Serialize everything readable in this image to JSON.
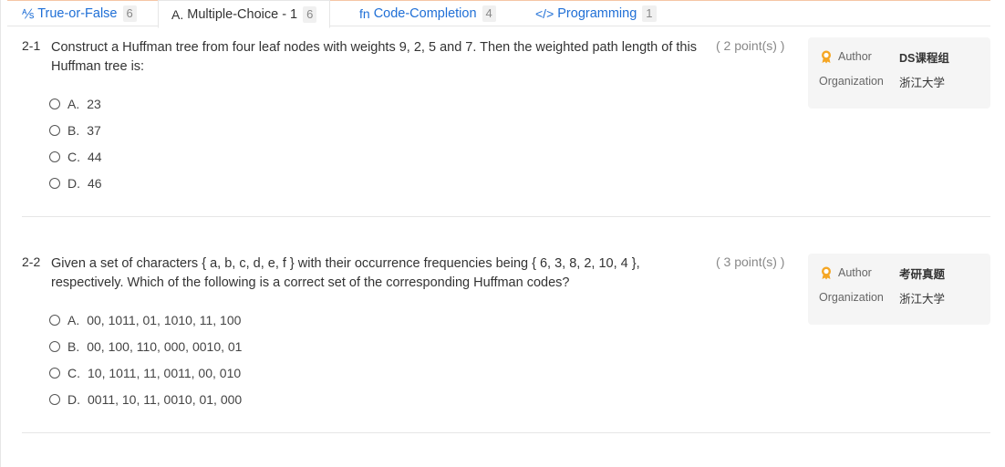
{
  "tabs": [
    {
      "icon": "⅍",
      "label": "True-or-False",
      "count": "6"
    },
    {
      "icon": "A.",
      "label": "Multiple-Choice - 1",
      "count": "6"
    },
    {
      "icon": "fn",
      "label": "Code-Completion",
      "count": "4"
    },
    {
      "icon": "</>",
      "label": "Programming",
      "count": "1"
    }
  ],
  "questions": [
    {
      "number": "2-1",
      "text": "Construct a Huffman tree from four leaf nodes with weights 9, 2, 5 and 7. Then the weighted path length of this Huffman tree is:",
      "points": "( 2 point(s) )",
      "options": [
        {
          "letter": "A.",
          "text": "23"
        },
        {
          "letter": "B.",
          "text": "37"
        },
        {
          "letter": "C.",
          "text": "44"
        },
        {
          "letter": "D.",
          "text": "46"
        }
      ],
      "author_label": "Author",
      "author": "DS课程组",
      "org_label": "Organization",
      "organization": "浙江大学"
    },
    {
      "number": "2-2",
      "text": "Given a set of characters { a, b, c, d, e, f } with their occurrence frequencies being { 6, 3, 8, 2, 10, 4 }, respectively. Which of the following is a correct set of the corresponding Huffman codes?",
      "points": "( 3 point(s) )",
      "options": [
        {
          "letter": "A.",
          "text": "00, 1011, 01, 1010, 11, 100"
        },
        {
          "letter": "B.",
          "text": "00, 100, 110, 000, 0010, 01"
        },
        {
          "letter": "C.",
          "text": "10, 1011, 11, 0011, 00, 010"
        },
        {
          "letter": "D.",
          "text": "0011, 10, 11, 0010, 01, 000"
        }
      ],
      "author_label": "Author",
      "author": "考研真题",
      "org_label": "Organization",
      "organization": "浙江大学"
    }
  ]
}
